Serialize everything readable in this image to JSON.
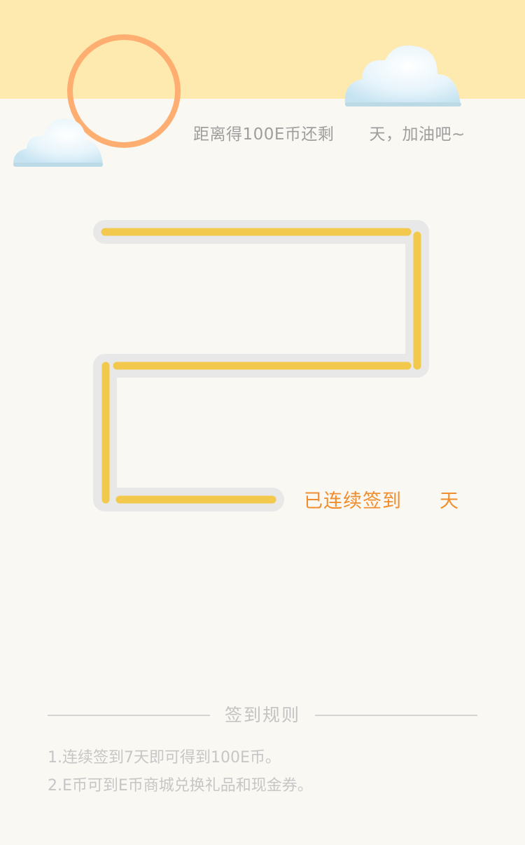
{
  "header": {
    "remaining_prefix": "距离得100E币还剩",
    "remaining_suffix": "天，加油吧~"
  },
  "progress": {
    "signed_prefix": "已连续签到",
    "signed_suffix": "天"
  },
  "rules": {
    "title": "签到规则",
    "items": [
      "1.连续签到7天即可得到100E币。",
      "2.E币可到E币商城兑换礼品和现金券。"
    ]
  },
  "colors": {
    "sky": "#fee9ae",
    "background": "#faf8f3",
    "sun_ring": "#ffae72",
    "track_bg": "#e8e8e8",
    "track_fill": "#f2c94c",
    "accent": "#f08d2e"
  },
  "icons": {
    "sun": "sun-icon",
    "cloud": "cloud-icon"
  }
}
